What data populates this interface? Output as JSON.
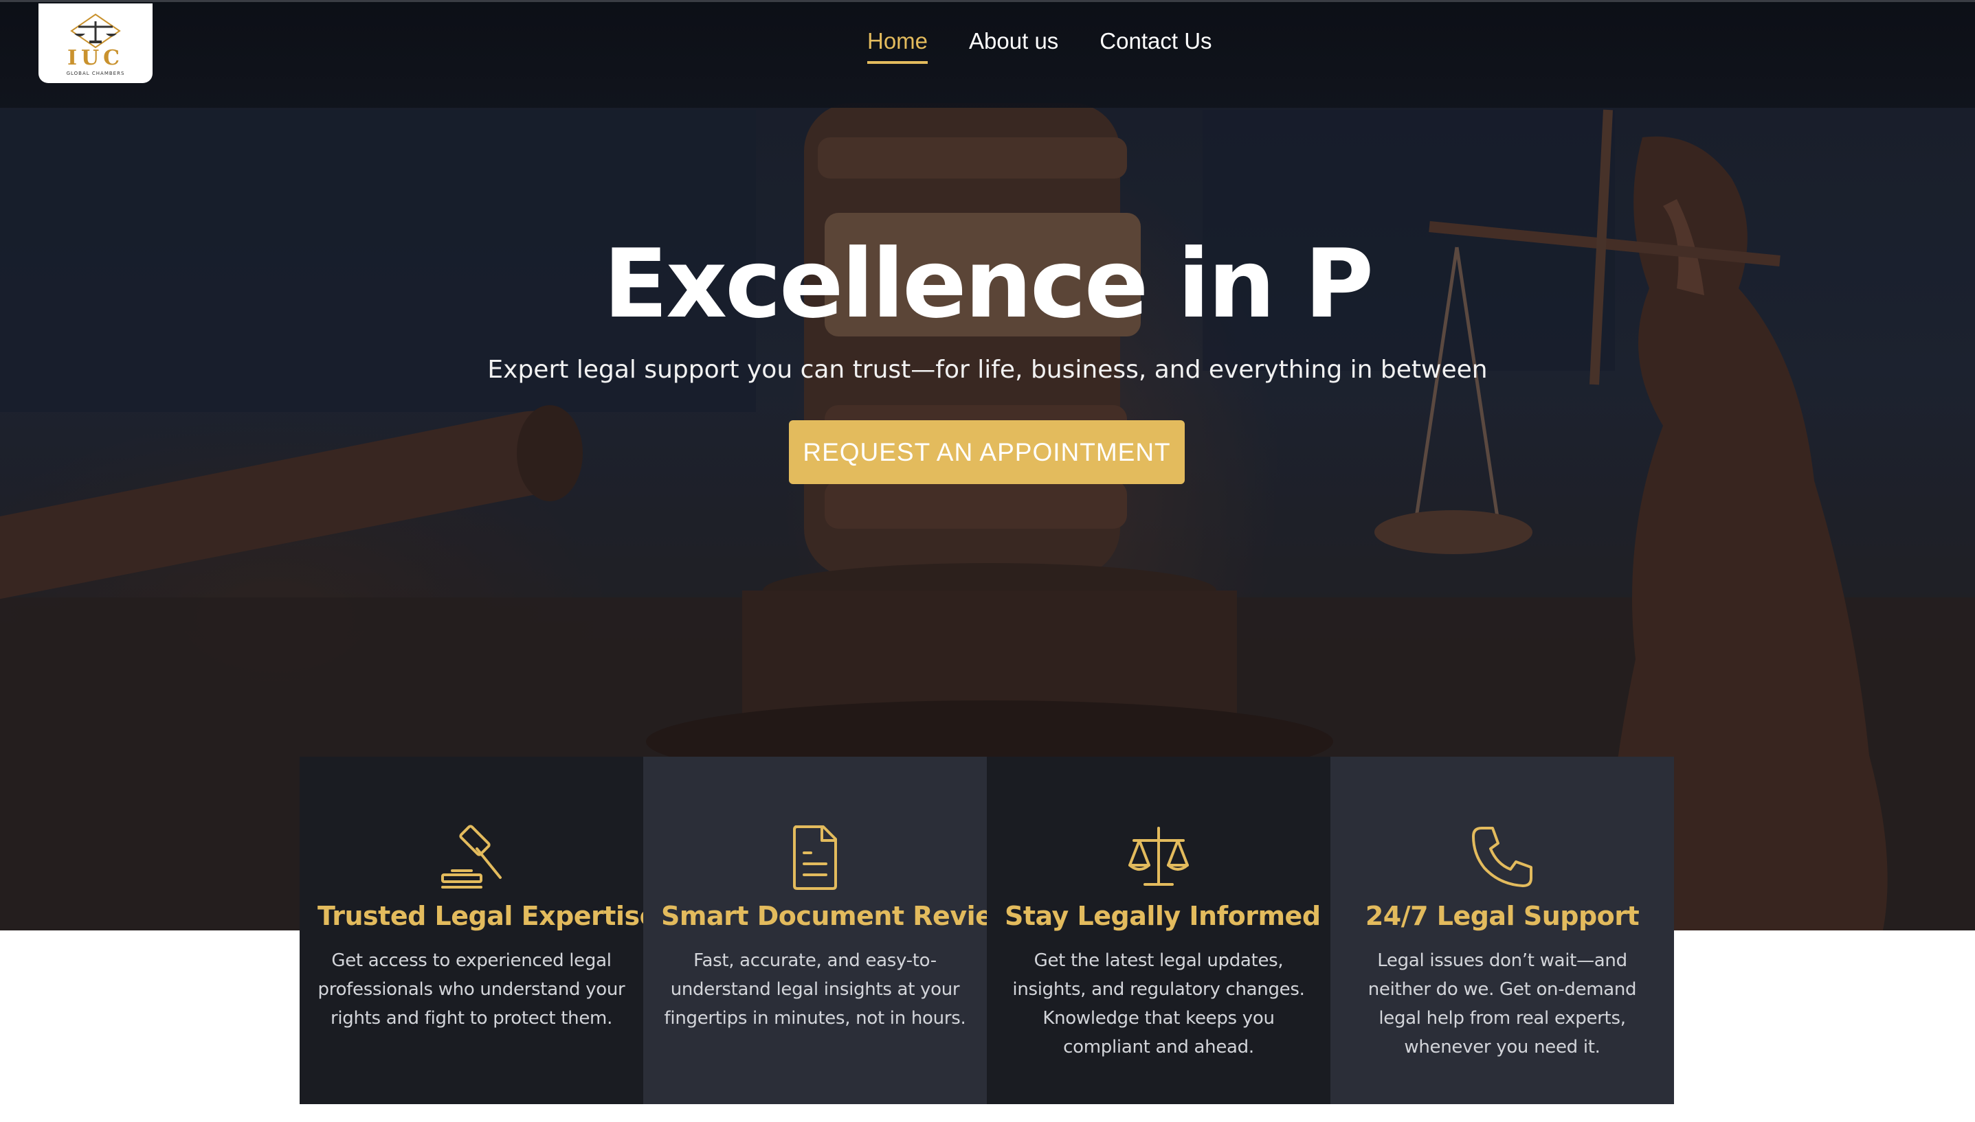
{
  "nav": {
    "logo_text": "IUC",
    "logo_subtext": "GLOBAL CHAMBERS",
    "links": [
      "Home",
      "About us",
      "Contact Us"
    ]
  },
  "hero": {
    "title": "Excellence in P",
    "subtitle": "Expert legal support you can trust—for life, business, and everything in between",
    "cta_label": "REQUEST AN APPOINTMENT"
  },
  "features": [
    {
      "icon": "gavel-icon",
      "title": "Trusted Legal Expertise",
      "text": "Get access to experienced legal professionals who understand your rights and fight to protect them."
    },
    {
      "icon": "document-icon",
      "title": "Smart Document Review",
      "text": "Fast, accurate, and easy-to-understand legal insights at your fingertips in minutes, not in hours."
    },
    {
      "icon": "scales-icon",
      "title": "Stay Legally Informed",
      "text": "Get the latest legal updates, insights, and regulatory changes. Knowledge that keeps you compliant and ahead."
    },
    {
      "icon": "phone-icon",
      "title": "24/7 Legal Support",
      "text": "Legal issues don’t wait—and neither do we. Get on-demand legal help from real experts, whenever you need it."
    }
  ],
  "colors": {
    "accent": "#e3bb5d",
    "card_dark": "#1a1c22",
    "card_mid": "#2b2e38",
    "nav_bg": "#10131b"
  }
}
